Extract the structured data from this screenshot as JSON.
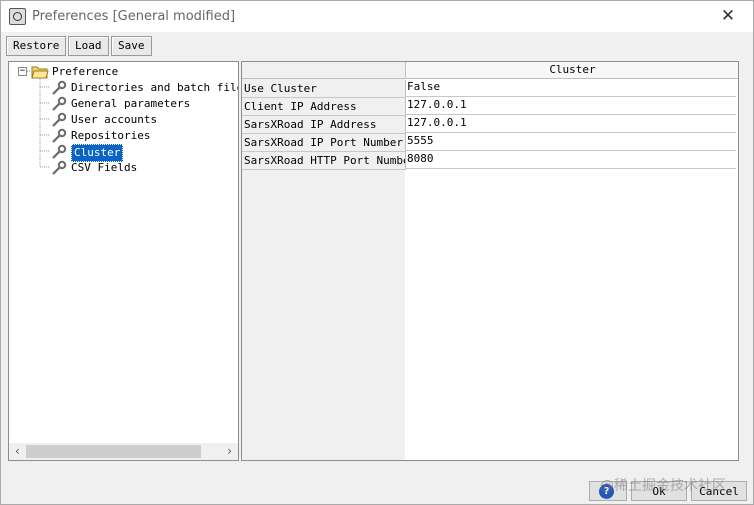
{
  "window": {
    "title": "Preferences [General modified]",
    "close_glyph": "✕"
  },
  "toolbar": {
    "restore_label": "Restore",
    "load_label": "Load",
    "save_label": "Save"
  },
  "tree": {
    "root_label": "Preference",
    "items": [
      {
        "label": "Directories and batch file r",
        "icon": "wrench-icon"
      },
      {
        "label": "General parameters",
        "icon": "wrench-icon"
      },
      {
        "label": "User accounts",
        "icon": "wrench-icon"
      },
      {
        "label": "Repositories",
        "icon": "wrench-icon"
      },
      {
        "label": "Cluster",
        "icon": "wrench-icon",
        "selected": true
      },
      {
        "label": "CSV Fields",
        "icon": "wrench-icon"
      }
    ]
  },
  "grid": {
    "column_header": "Cluster",
    "rows": [
      {
        "name": "Use Cluster",
        "value": "False"
      },
      {
        "name": "Client IP Address",
        "value": "127.0.0.1"
      },
      {
        "name": "SarsXRoad IP Address",
        "value": "127.0.0.1"
      },
      {
        "name": "SarsXRoad IP Port Number",
        "value": "5555"
      },
      {
        "name": "SarsXRoad HTTP Port Number",
        "value": "8080"
      }
    ]
  },
  "footer": {
    "ok_label": "Ok",
    "cancel_label": "Cancel",
    "help_glyph": "?"
  },
  "watermark": "@稀土掘金技术社区",
  "colors": {
    "selection": "#0a64c8",
    "help": "#2457b8"
  }
}
